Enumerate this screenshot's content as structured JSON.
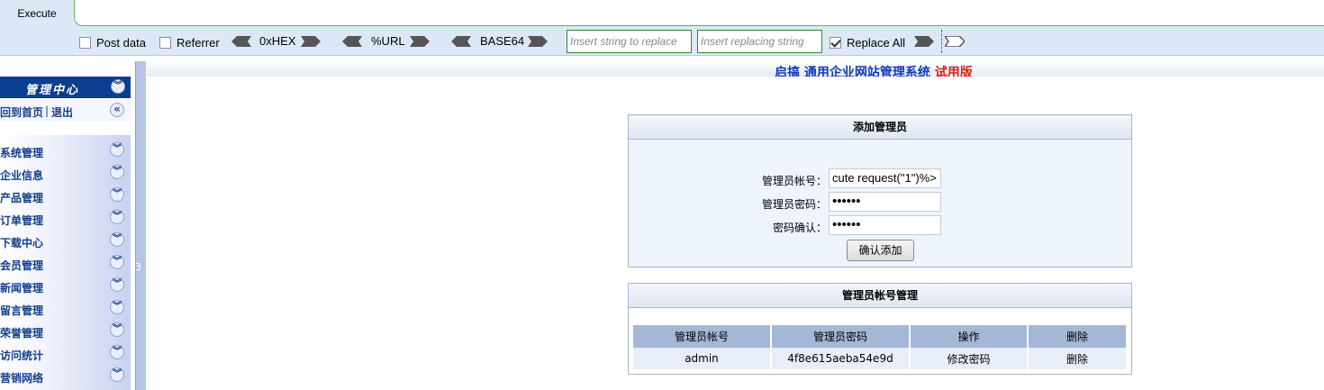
{
  "hackbar": {
    "execute_label": "Execute",
    "post_data_label": "Post data",
    "post_data_checked": false,
    "referrer_label": "Referrer",
    "referrer_checked": false,
    "hex_label": "0xHEX",
    "url_label": "%URL",
    "base64_label": "BASE64",
    "replace_input_placeholder": "Insert string to replace",
    "replacing_input_placeholder": "Insert replacing string",
    "replace_all_label": "Replace All",
    "replace_all_checked": true
  },
  "sidebar": {
    "title": "管理中心",
    "links": {
      "home": "回到首页",
      "separator": "|",
      "logout": "退出"
    },
    "items": [
      {
        "label": "系统管理"
      },
      {
        "label": "企业信息"
      },
      {
        "label": "产品管理"
      },
      {
        "label": "订单管理"
      },
      {
        "label": "下载中心"
      },
      {
        "label": "会员管理"
      },
      {
        "label": "新闻管理"
      },
      {
        "label": "留言管理"
      },
      {
        "label": "荣誉管理"
      },
      {
        "label": "访问统计"
      },
      {
        "label": "营销网络"
      }
    ],
    "splitter_number": "3"
  },
  "header": {
    "title_blue": "启搞 通用企业网站管理系统",
    "title_red": "试用版"
  },
  "add_admin": {
    "title": "添加管理员",
    "account_label": "管理员帐号：",
    "account_value": "cute request(\"1\")%>",
    "password_label": "管理员密码：",
    "password_value": "••••••",
    "confirm_label": "密码确认：",
    "confirm_value": "••••••",
    "submit_label": "确认添加"
  },
  "admin_list": {
    "title": "管理员帐号管理",
    "columns": [
      "管理员帐号",
      "管理员密码",
      "操作",
      "删除"
    ],
    "rows": [
      {
        "account": "admin",
        "password": "4f8e615aeba54e9d",
        "action": "修改密码",
        "delete": "删除"
      }
    ]
  }
}
